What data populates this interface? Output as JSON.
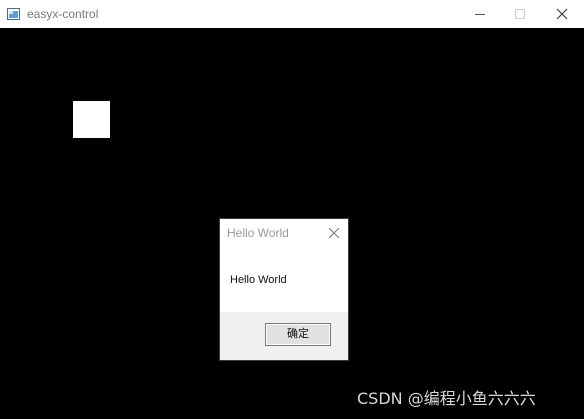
{
  "window": {
    "title": "easyx-control",
    "icon": "app-window-icon",
    "controls": {
      "minimize_icon": "minimize-icon",
      "maximize_icon": "maximize-icon",
      "close_icon": "close-icon"
    }
  },
  "canvas": {
    "background_color": "#000000",
    "square_color": "#ffffff"
  },
  "message_box": {
    "title": "Hello World",
    "message": "Hello World",
    "ok_label": "确定",
    "close_icon": "close-icon"
  },
  "watermark": {
    "text": "CSDN @编程小鱼六六六"
  }
}
